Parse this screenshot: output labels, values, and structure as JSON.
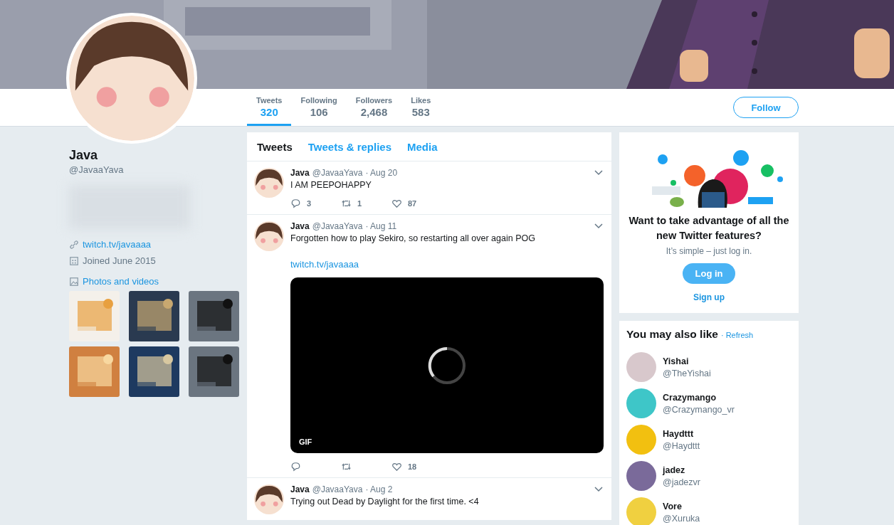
{
  "profile_nav": {
    "stats": [
      {
        "label": "Tweets",
        "value": "320",
        "selected": true
      },
      {
        "label": "Following",
        "value": "106",
        "selected": false
      },
      {
        "label": "Followers",
        "value": "2,468",
        "selected": false
      },
      {
        "label": "Likes",
        "value": "583",
        "selected": false
      }
    ],
    "follow_button": "Follow"
  },
  "profile": {
    "name": "Java",
    "handle": "@JavaaYava",
    "bio_blurred": true,
    "link": "twitch.tv/javaaaa",
    "joined": "Joined June 2015",
    "photos_label": "Photos and videos"
  },
  "timeline": {
    "tabs": [
      {
        "label": "Tweets",
        "selected": true
      },
      {
        "label": "Tweets & replies",
        "selected": false
      },
      {
        "label": "Media",
        "selected": false
      }
    ],
    "tweets": [
      {
        "name": "Java",
        "handle": "@JavaaYava",
        "date": "· Aug 20",
        "text": "I AM PEEPOHAPPY",
        "replies": "3",
        "retweets": "1",
        "likes": "87"
      },
      {
        "name": "Java",
        "handle": "@JavaaYava",
        "date": "· Aug 11",
        "text": "Forgotten how to play Sekiro, so restarting all over again POG",
        "link": "twitch.tv/javaaaa",
        "media": {
          "kind": "gif",
          "badge": "GIF",
          "loading": true
        },
        "likes": "18"
      },
      {
        "name": "Java",
        "handle": "@JavaaYava",
        "date": "· Aug 2",
        "text": "Trying out Dead by Daylight for the first time. <4"
      }
    ]
  },
  "signup_card": {
    "title": "Want to take advantage of all the new Twitter features?",
    "subtitle": "It’s simple – just log in.",
    "login_button": "Log in",
    "signup_link": "Sign up"
  },
  "suggestions": {
    "title": "You may also like",
    "refresh": "· Refresh",
    "accounts": [
      {
        "name": "Yishai",
        "handle": "@TheYishai",
        "color": "#d8c8cc"
      },
      {
        "name": "Crazymango",
        "handle": "@Crazymango_vr",
        "color": "#3ec6c8"
      },
      {
        "name": "Haydttt",
        "handle": "@Haydttt",
        "color": "#f2c010"
      },
      {
        "name": "jadez",
        "handle": "@jadezvr",
        "color": "#7a6a9a"
      },
      {
        "name": "Vore",
        "handle": "@Xuruka",
        "color": "#f0d040"
      }
    ]
  }
}
